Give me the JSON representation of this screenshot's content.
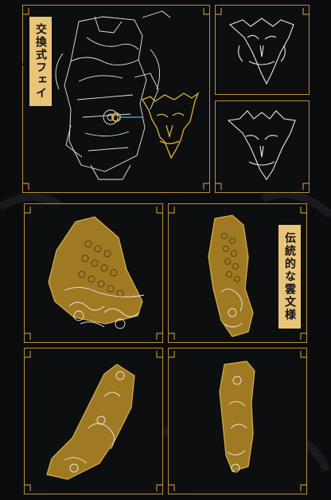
{
  "labels": {
    "face_title": "交換式フェイス",
    "pattern_title": "伝統的な雲文様"
  },
  "colors": {
    "background": "#0b0c0e",
    "gold_frame": "#b88e3e",
    "gold_fill": "#a67d1f",
    "label_bg": "#e9c57a",
    "line_white": "#e8e8e8",
    "connector_blue": "#3a9bd8"
  }
}
